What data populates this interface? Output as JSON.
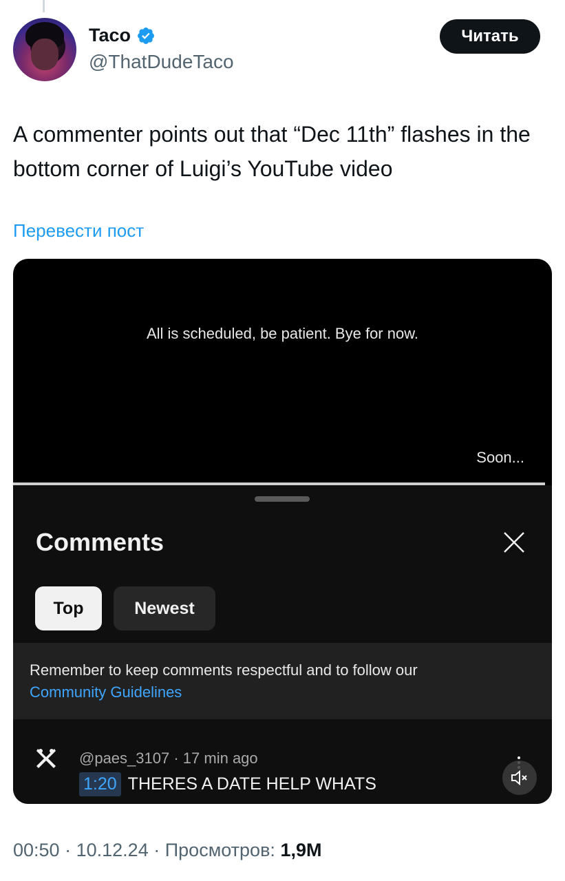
{
  "author": {
    "name": "Taco",
    "handle": "@ThatDudeTaco",
    "verified": true
  },
  "follow_button": "Читать",
  "tweet": {
    "text": "A commenter points out that “Dec 11th” flashes in the bottom corner of Luigi’s YouTube video",
    "translate_link": "Перевести пост"
  },
  "media": {
    "video_caption": "All is scheduled, be patient. Bye for now.",
    "corner_text": "Soon...",
    "comments_panel": {
      "title": "Comments",
      "chips": [
        "Top",
        "Newest"
      ],
      "selected_chip": "Top",
      "notice": "Remember to keep comments respectful and to follow our",
      "notice_link": "Community Guidelines",
      "comment": {
        "author": "@paes_3107",
        "separator": "·",
        "time": "17 min ago",
        "timestamp": "1:20",
        "text": "THERES A DATE HELP WHATS"
      }
    }
  },
  "footer": {
    "time": "00:50",
    "sep1": "·",
    "date": "10.12.24",
    "sep2": "·",
    "views_label": "Просмотров:",
    "views_count": "1,9M"
  },
  "colors": {
    "accent": "#1d9bf0",
    "youtube_link": "#3ea6ff",
    "dark_bg": "#0f0f0f"
  },
  "icons": [
    "verified-badge-icon",
    "close-icon",
    "x-shaped-avatar-icon",
    "more-vert-icon",
    "mute-icon"
  ]
}
